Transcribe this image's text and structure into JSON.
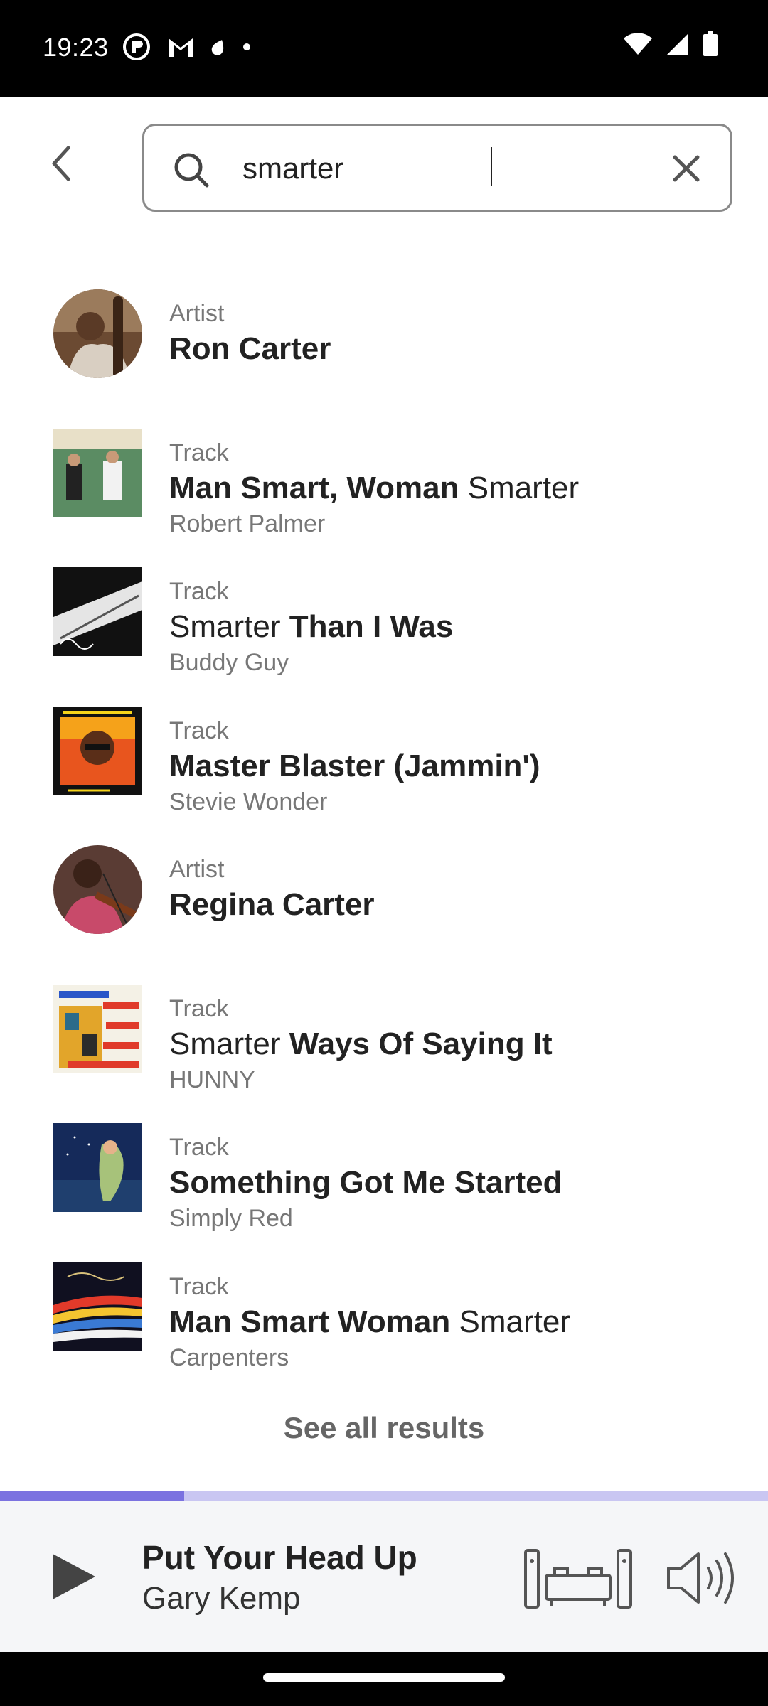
{
  "status_bar": {
    "time": "19:23",
    "left_icons": [
      "vpn-icon",
      "gmail-icon",
      "notification-icon",
      "dot-icon"
    ],
    "right_icons": [
      "wifi-icon",
      "signal-icon",
      "battery-icon"
    ]
  },
  "search": {
    "query": "smarter",
    "placeholder": ""
  },
  "results": [
    {
      "type": "Artist",
      "title_parts": [
        {
          "text": "Ron Carter",
          "bold": true
        }
      ],
      "subtitle": "",
      "shape": "round"
    },
    {
      "type": "Track",
      "title_parts": [
        {
          "text": "Man Smart, Woman",
          "bold": true
        },
        {
          "text": " Smarter",
          "bold": false
        }
      ],
      "subtitle": "Robert Palmer",
      "shape": "square"
    },
    {
      "type": "Track",
      "title_parts": [
        {
          "text": "Smarter ",
          "bold": false
        },
        {
          "text": "Than I Was",
          "bold": true
        }
      ],
      "subtitle": "Buddy Guy",
      "shape": "square"
    },
    {
      "type": "Track",
      "title_parts": [
        {
          "text": "Master Blaster (Jammin')",
          "bold": true
        }
      ],
      "subtitle": "Stevie Wonder",
      "shape": "square"
    },
    {
      "type": "Artist",
      "title_parts": [
        {
          "text": "Regina Carter",
          "bold": true
        }
      ],
      "subtitle": "",
      "shape": "round"
    },
    {
      "type": "Track",
      "title_parts": [
        {
          "text": "Smarter ",
          "bold": false
        },
        {
          "text": "Ways Of Saying It",
          "bold": true
        }
      ],
      "subtitle": "HUNNY",
      "shape": "square"
    },
    {
      "type": "Track",
      "title_parts": [
        {
          "text": "Something Got Me Started",
          "bold": true
        }
      ],
      "subtitle": "Simply Red",
      "shape": "square"
    },
    {
      "type": "Track",
      "title_parts": [
        {
          "text": "Man Smart Woman",
          "bold": true
        },
        {
          "text": " Smarter",
          "bold": false
        }
      ],
      "subtitle": "Carpenters",
      "shape": "square"
    }
  ],
  "see_all_label": "See all results",
  "player": {
    "title": "Put Your Head Up",
    "artist": "Gary Kemp",
    "progress": 0.24
  },
  "colors": {
    "accent": "#7b72e0",
    "accent_light": "#c9c6f2"
  }
}
